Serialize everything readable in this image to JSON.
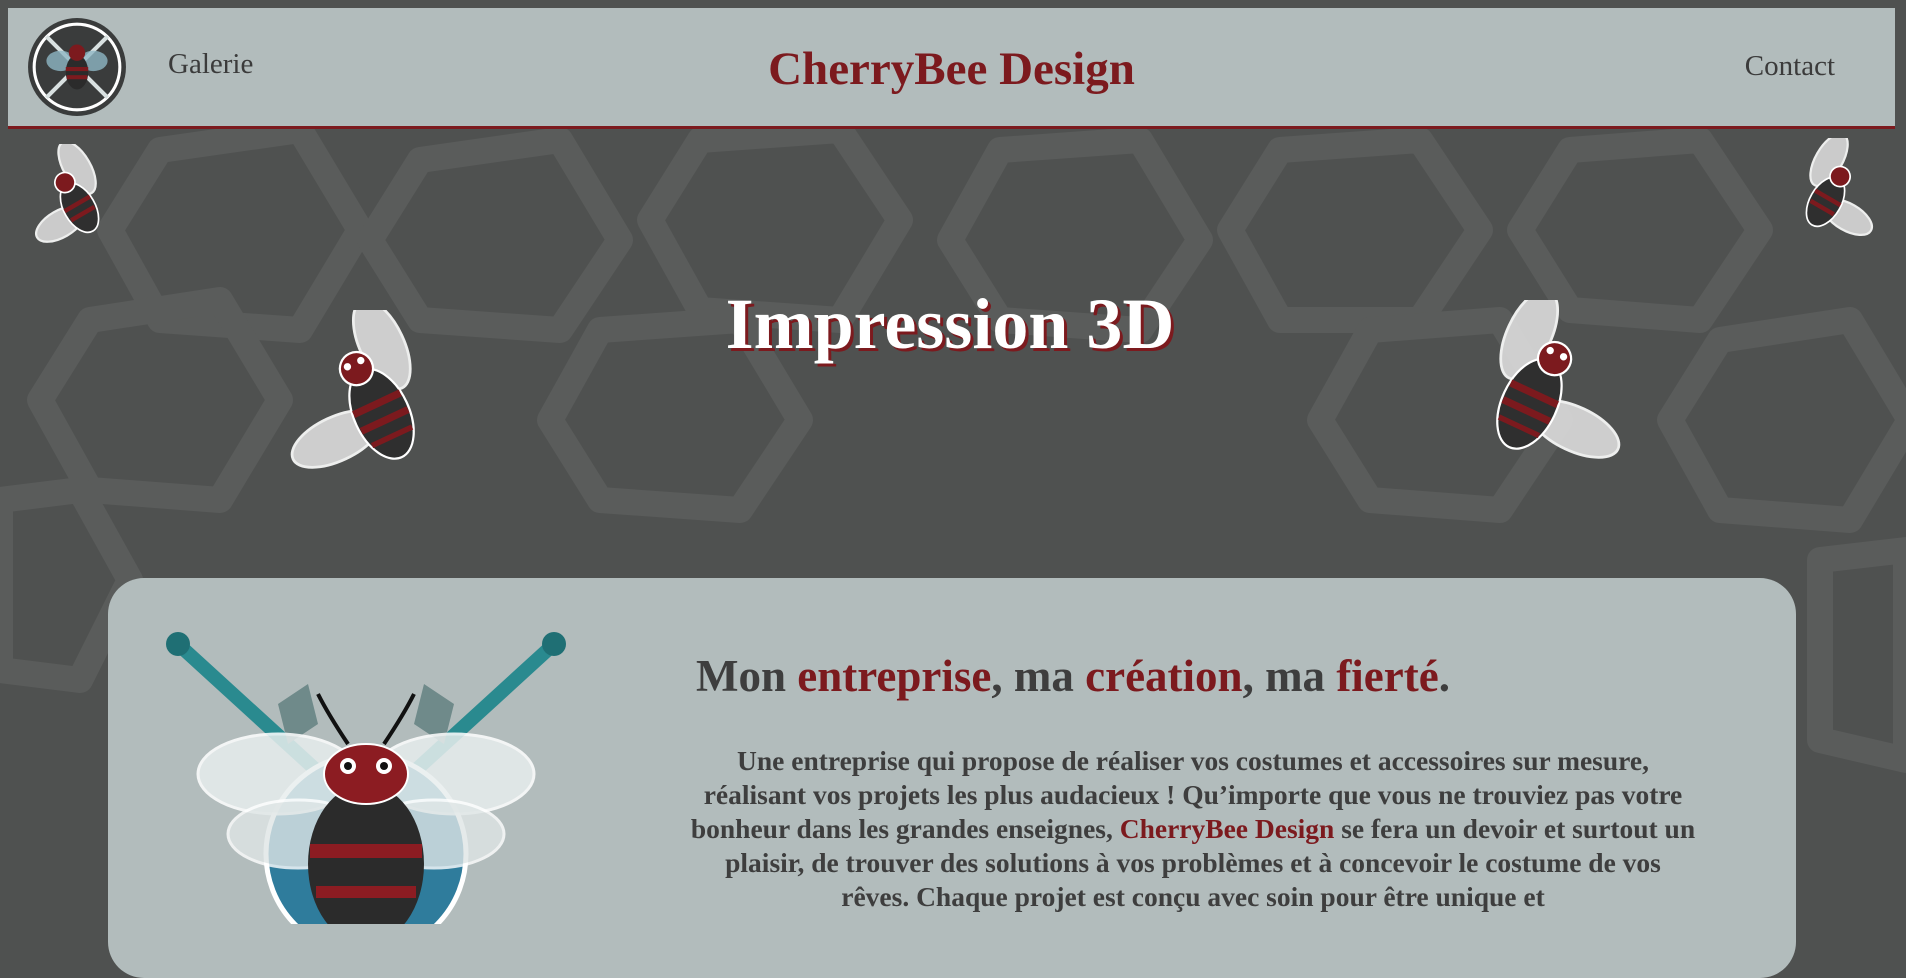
{
  "header": {
    "brand": "CherryBee Design",
    "nav_left": "Galerie",
    "nav_right": "Contact",
    "logo_icon": "bee-swords-logo-icon"
  },
  "hero": {
    "title": "Impression 3D"
  },
  "intro": {
    "slogan": {
      "w1": "Mon ",
      "w2": "entreprise",
      "w3": ", ma ",
      "w4": "création",
      "w5": ", ma ",
      "w6": "fierté",
      "w7": "."
    },
    "paragraph": {
      "before": "Une entreprise qui propose de réaliser vos costumes et accessoires sur mesure, réalisant vos projets les plus audacieux ! Qu’importe que vous ne trouviez pas votre bonheur dans les grandes enseignes, ",
      "brand": "CherryBee Design",
      "after": " se fera un devoir et surtout un plaisir, de trouver des solutions à vos problèmes et à concevoir le costume de vos rêves. Chaque projet est conçu avec soin pour être unique et"
    }
  },
  "colors": {
    "background": "#4f5150",
    "header_bg": "#b2bcbc",
    "accent": "#7c1a1e",
    "text_dark": "#3e3e3e",
    "hero_text": "#ffffff",
    "teal": "#2a8a8f"
  },
  "icons": [
    "bee-icon",
    "bee-swords-logo-icon",
    "bee-emblem-icon"
  ]
}
